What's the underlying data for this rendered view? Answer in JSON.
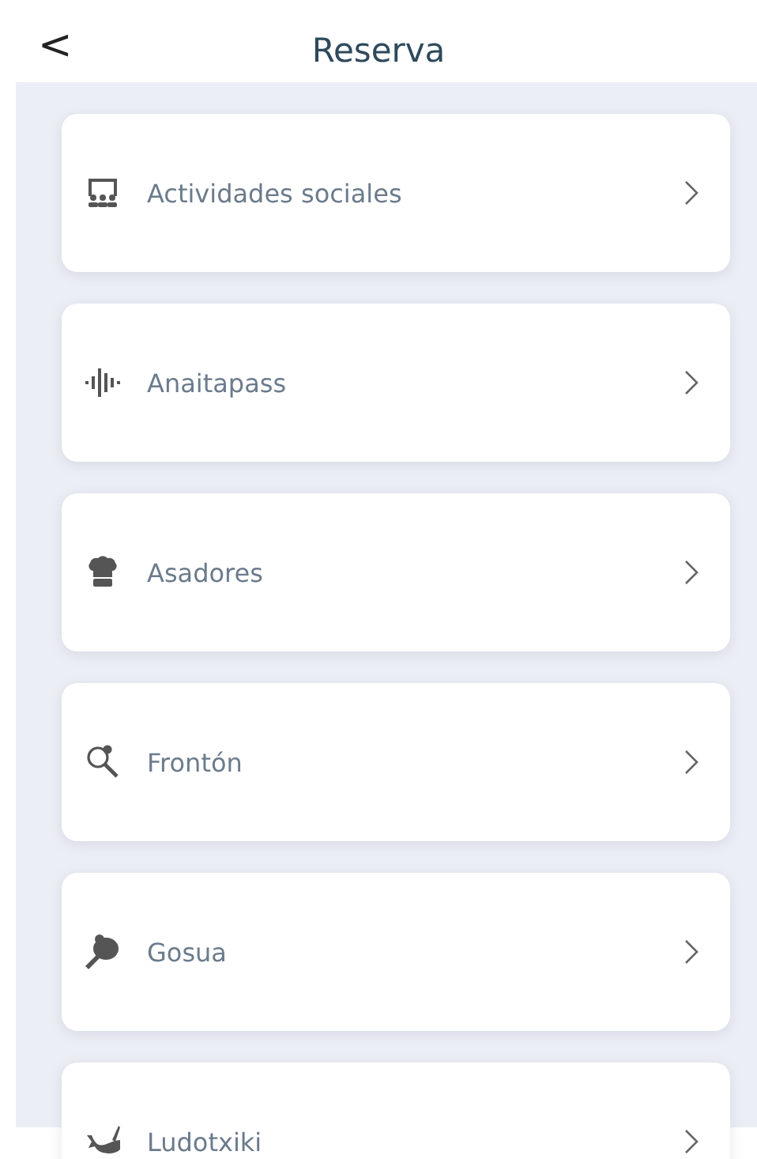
{
  "header": {
    "back": "<",
    "title": "Reserva"
  },
  "items": [
    {
      "label": "Actividades sociales",
      "kind": "group"
    },
    {
      "label": "Anaitapass",
      "kind": "wave"
    },
    {
      "label": "Asadores",
      "kind": "chef"
    },
    {
      "label": "Frontón",
      "kind": "racket"
    },
    {
      "label": "Gosua",
      "kind": "paddle"
    },
    {
      "label": "Ludotxiki",
      "kind": "whale"
    }
  ]
}
